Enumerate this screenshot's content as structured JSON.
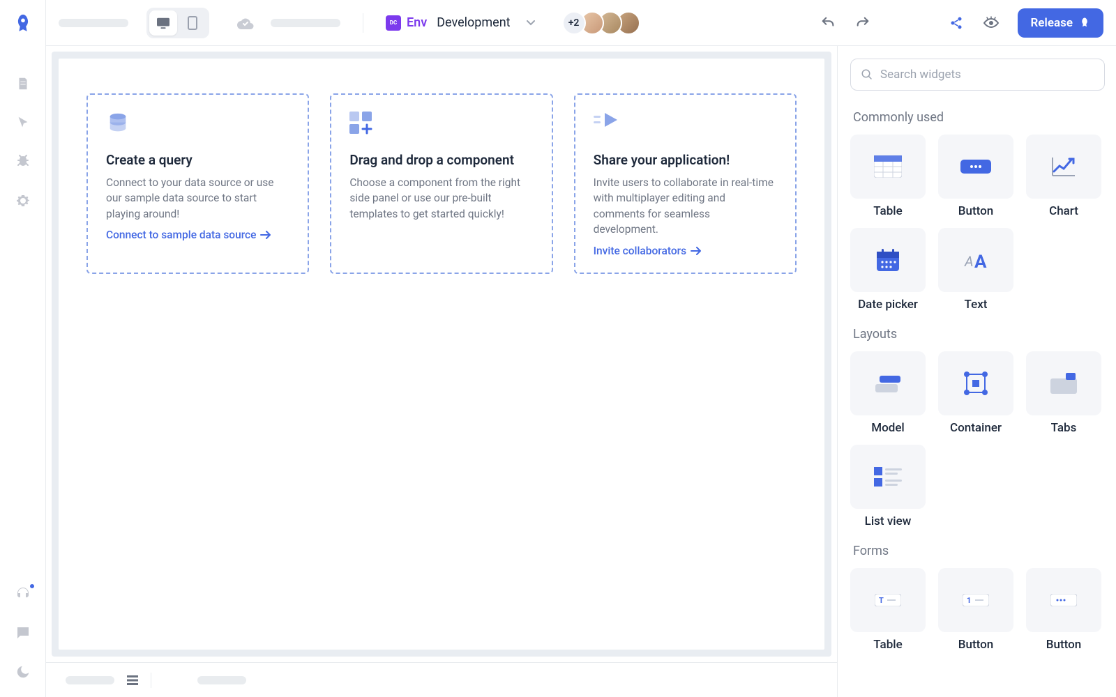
{
  "topbar": {
    "env_label": "Env",
    "env_value": "Development",
    "avatar_overflow": "+2",
    "release_label": "Release"
  },
  "search": {
    "placeholder": "Search widgets"
  },
  "onboarding": {
    "cards": [
      {
        "title": "Create a query",
        "desc": "Connect to your data source or use our sample data source to start playing around!",
        "link": "Connect to sample data source"
      },
      {
        "title": "Drag and drop a component",
        "desc": "Choose a component from the right side panel or use our pre-built templates to get started quickly!",
        "link": ""
      },
      {
        "title": "Share your application!",
        "desc": "Invite users to collaborate in real-time with multiplayer editing and comments for seamless development.",
        "link": "Invite collaborators"
      }
    ]
  },
  "widget_groups": [
    {
      "heading": "Commonly  used",
      "items": [
        "Table",
        "Button",
        "Chart",
        "Date picker",
        "Text"
      ]
    },
    {
      "heading": "Layouts",
      "items": [
        "Model",
        "Container",
        "Tabs",
        "List view"
      ]
    },
    {
      "heading": "Forms",
      "items": [
        "Table",
        "Button",
        "Button"
      ]
    }
  ]
}
